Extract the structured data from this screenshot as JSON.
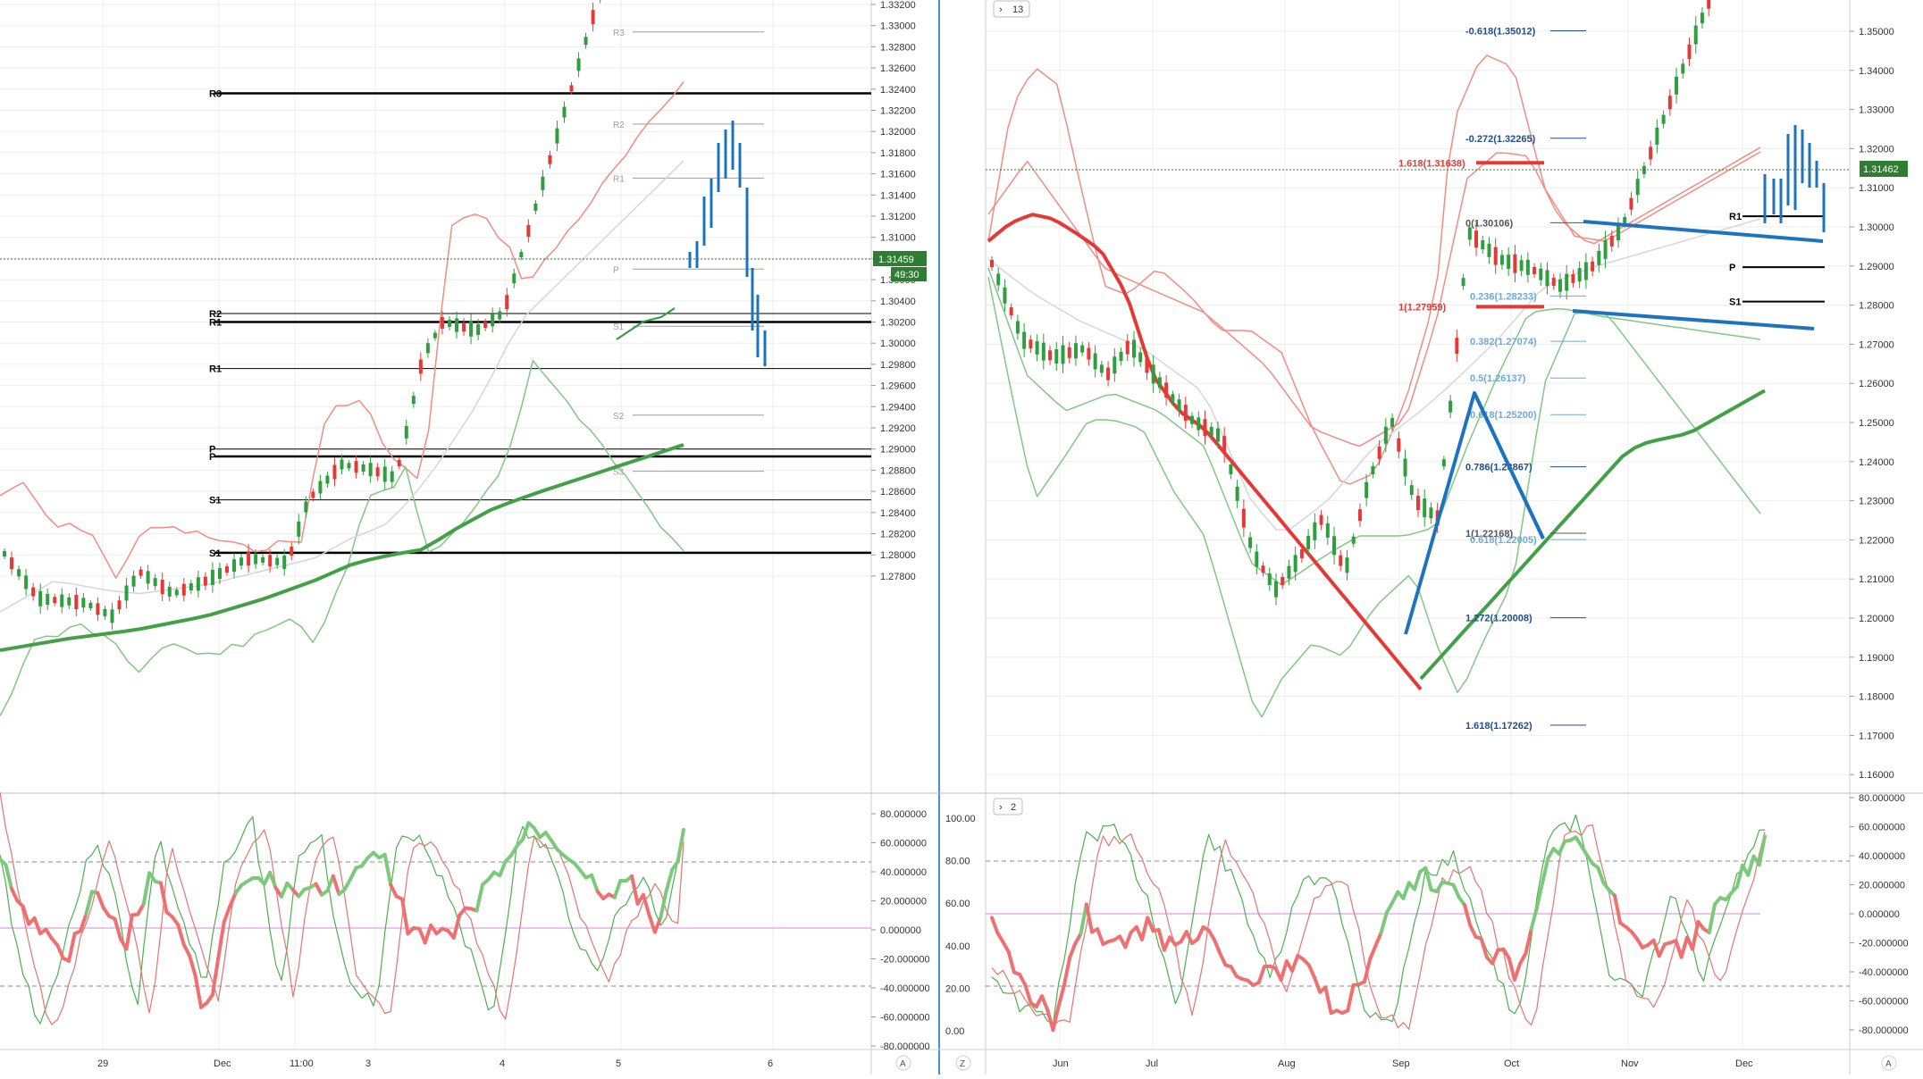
{
  "colors": {
    "bull": "#2e9e3e",
    "bear": "#e53935",
    "bb_upper": "#f28b82",
    "bb_lower": "#81c784",
    "ma_fast": "#e53935",
    "ma_slow": "#43a047",
    "accent_blue": "#1e73be",
    "grid": "#eeeeee",
    "price_line": "#2e7d32",
    "fib_blue": "#1f4e8c",
    "fib_red": "#e53935",
    "fib_light": "#6fa8dc",
    "zero_line": "#d48ad8"
  },
  "left_chart": {
    "price_label": "1.31459",
    "countdown": "49:30",
    "axis_corner": "A",
    "price_ticks": [
      "1.33200",
      "1.33000",
      "1.32800",
      "1.32600",
      "1.32400",
      "1.32200",
      "1.32000",
      "1.31800",
      "1.31600",
      "1.31400",
      "1.31200",
      "1.31000",
      "1.30800",
      "1.30600",
      "1.30400",
      "1.30200",
      "1.30000",
      "1.29800",
      "1.29600",
      "1.29400",
      "1.29200",
      "1.29000",
      "1.28800",
      "1.28600",
      "1.28400",
      "1.28200",
      "1.28000",
      "1.27800"
    ],
    "time_labels": [
      "29",
      "Dec",
      "11:00",
      "3",
      "4",
      "5",
      "6"
    ],
    "levels": [
      {
        "label": "R3",
        "price": 1.3236,
        "style": "bold"
      },
      {
        "label": "R2",
        "price": 1.3028,
        "style": "thin"
      },
      {
        "label": "R1",
        "price": 1.302,
        "style": "bold"
      },
      {
        "label": "R1",
        "price": 1.2976,
        "style": "thin"
      },
      {
        "label": "P",
        "price": 1.29,
        "style": "thin"
      },
      {
        "label": "P",
        "price": 1.2893,
        "style": "bold"
      },
      {
        "label": "S1",
        "price": 1.2852,
        "style": "thin"
      },
      {
        "label": "S1",
        "price": 1.2802,
        "style": "bold"
      }
    ],
    "pivot_labels": [
      {
        "label": "R3",
        "price": 1.3294
      },
      {
        "label": "R2",
        "price": 1.3207
      },
      {
        "label": "R1",
        "price": 1.3156
      },
      {
        "label": "P",
        "price": 1.307
      },
      {
        "label": "S1",
        "price": 1.3016
      },
      {
        "label": "S2",
        "price": 1.2932
      },
      {
        "label": "S3",
        "price": 1.2879
      }
    ],
    "stoch_ticks": [
      "80.000000",
      "60.000000",
      "40.000000",
      "20.000000",
      "0.000000",
      "-20.000000",
      "-40.000000",
      "-60.000000",
      "-80.000000"
    ]
  },
  "right_chart": {
    "badge_top": "13",
    "badge_bottom": "2",
    "price_label": "1.31462",
    "axis_corner_left": "Z",
    "axis_corner_right": "A",
    "price_ticks": [
      "1.35000",
      "1.34000",
      "1.33000",
      "1.32000",
      "1.31000",
      "1.30000",
      "1.29000",
      "1.28000",
      "1.27000",
      "1.26000",
      "1.25000",
      "1.24000",
      "1.23000",
      "1.22000",
      "1.21000",
      "1.20000",
      "1.19000",
      "1.18000",
      "1.17000",
      "1.16000"
    ],
    "time_labels": [
      "Jun",
      "Jul",
      "Aug",
      "Sep",
      "Oct",
      "Nov",
      "Dec"
    ],
    "fib_labels": [
      {
        "text": "-0.618(1.35012)",
        "price": 1.35012,
        "color": "blue"
      },
      {
        "text": "-0.272(1.32265)",
        "price": 1.32265,
        "color": "blue"
      },
      {
        "text": "1.618(1.31638)",
        "price": 1.31638,
        "color": "red"
      },
      {
        "text": "0(1.30106)",
        "price": 1.30106,
        "color": "gray"
      },
      {
        "text": "0.236(1.28233)",
        "price": 1.28233,
        "color": "light"
      },
      {
        "text": "1(1.27959)",
        "price": 1.27959,
        "color": "red"
      },
      {
        "text": "0.382(1.27074)",
        "price": 1.27074,
        "color": "light"
      },
      {
        "text": "0.5(1.26137)",
        "price": 1.26137,
        "color": "light"
      },
      {
        "text": "0.618(1.25200)",
        "price": 1.252,
        "color": "light"
      },
      {
        "text": "0.786(1.23867)",
        "price": 1.23867,
        "color": "blue"
      },
      {
        "text": "1(1.22168)",
        "price": 1.22168,
        "color": "gray"
      },
      {
        "text": "0.618(1.22005)",
        "price": 1.22005,
        "color": "light"
      },
      {
        "text": "1.272(1.20008)",
        "price": 1.20008,
        "color": "blue"
      },
      {
        "text": "1.618(1.17262)",
        "price": 1.17262,
        "color": "blue"
      }
    ],
    "levels": [
      {
        "label": "R1",
        "price": 1.3027
      },
      {
        "label": "P",
        "price": 1.2897
      },
      {
        "label": "S1",
        "price": 1.2809
      }
    ],
    "stoch_left_ticks": [
      "100.00",
      "80.00",
      "60.00",
      "40.00",
      "20.00",
      "0.00"
    ],
    "stoch_right_ticks": [
      "80.000000",
      "60.000000",
      "40.000000",
      "20.000000",
      "0.000000",
      "-20.000000",
      "-40.000000",
      "-60.000000",
      "-80.000000"
    ]
  }
}
